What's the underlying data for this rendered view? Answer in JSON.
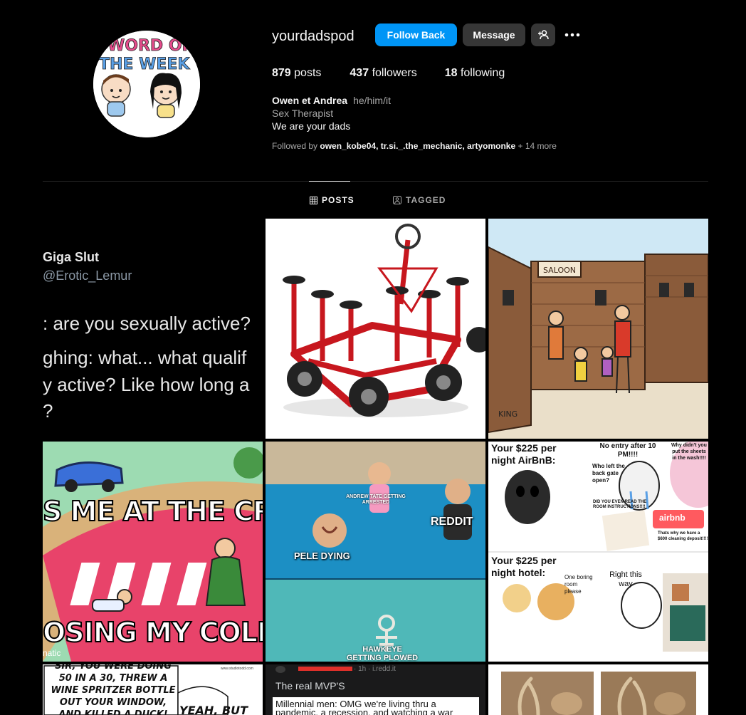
{
  "profile": {
    "username": "yourdadspod",
    "avatar_text": "WORD OF THE WEEK",
    "buttons": {
      "follow_back": "Follow Back",
      "message": "Message"
    },
    "stats": {
      "posts_count": "879",
      "posts_label": "posts",
      "followers_count": "437",
      "followers_label": "followers",
      "following_count": "18",
      "following_label": "following"
    },
    "bio": {
      "name": "Owen et Andrea",
      "pronouns": "he/him/it",
      "category": "Sex Therapist",
      "text": "We are your dads"
    },
    "followed_by": {
      "prefix": "Followed by",
      "users": "owen_kobe04, tr.si._.the_mechanic, artyomonke",
      "more": "+ 14 more"
    }
  },
  "tabs": [
    {
      "label": "POSTS",
      "active": true,
      "icon": "grid-icon"
    },
    {
      "label": "TAGGED",
      "active": false,
      "icon": "tag-icon"
    }
  ],
  "posts": {
    "p1": {
      "name": "Giga Slut",
      "handle": "@Erotic_Lemur",
      "line1": ": are you sexually active?",
      "line2": "ghing: what... what qualif",
      "line3": "y active? Like how long a",
      "line4": "?"
    },
    "p3": {
      "sign": "SALOON",
      "signature": "KING"
    },
    "p4": {
      "top": "S ME AT THE CROSSR",
      "bottom": "OSING MY COLLIS",
      "corner": "natic"
    },
    "p5": {
      "cap1": "ANDREW TATE GETTING ARRESTED",
      "cap2": "REDDIT",
      "cap3": "PELE DYING",
      "cap4": "HAWKEYE GETTING PLOWED"
    },
    "p6": {
      "airbnb_title": "Your $225 per night AirBnB:",
      "no_entry": "No entry after 10 PM!!!!",
      "why_didnt": "Why didn't you put the sheets in the wash!!!!",
      "who_left": "Who left the back gate open?",
      "did_you": "DID YOU EVEN READ THE ROOM INSTRUCTIONS!!!!",
      "airbnb_logo": "airbnb",
      "cleaning": "Thats why we have a $600 cleaning deposit!!!!",
      "hotel_title": "Your $225 per night hotel:",
      "boring": "One boring room please",
      "right": "Right this way"
    },
    "p7": {
      "line1": "SIR, YOU WERE DOING",
      "line2": "50 IN A 30, THREW A",
      "line3": "WINE SPRITZER BOTTLE",
      "line4": "OUT YOUR WINDOW,",
      "line5": "AND KILLED A DUCK!",
      "yeah": "YEAH, BUT",
      "site": "www.studiotodd.com"
    },
    "p8": {
      "meta": "· 1h · i.redd.it",
      "title": "The real MVP'S",
      "body": "Millennial men: OMG we're living thru a pandemic, a recession, and watching a war"
    }
  },
  "colors": {
    "background": "#000000",
    "primary_button": "#0095f6",
    "secondary_button": "#363636",
    "muted_text": "#a8a8a8"
  }
}
